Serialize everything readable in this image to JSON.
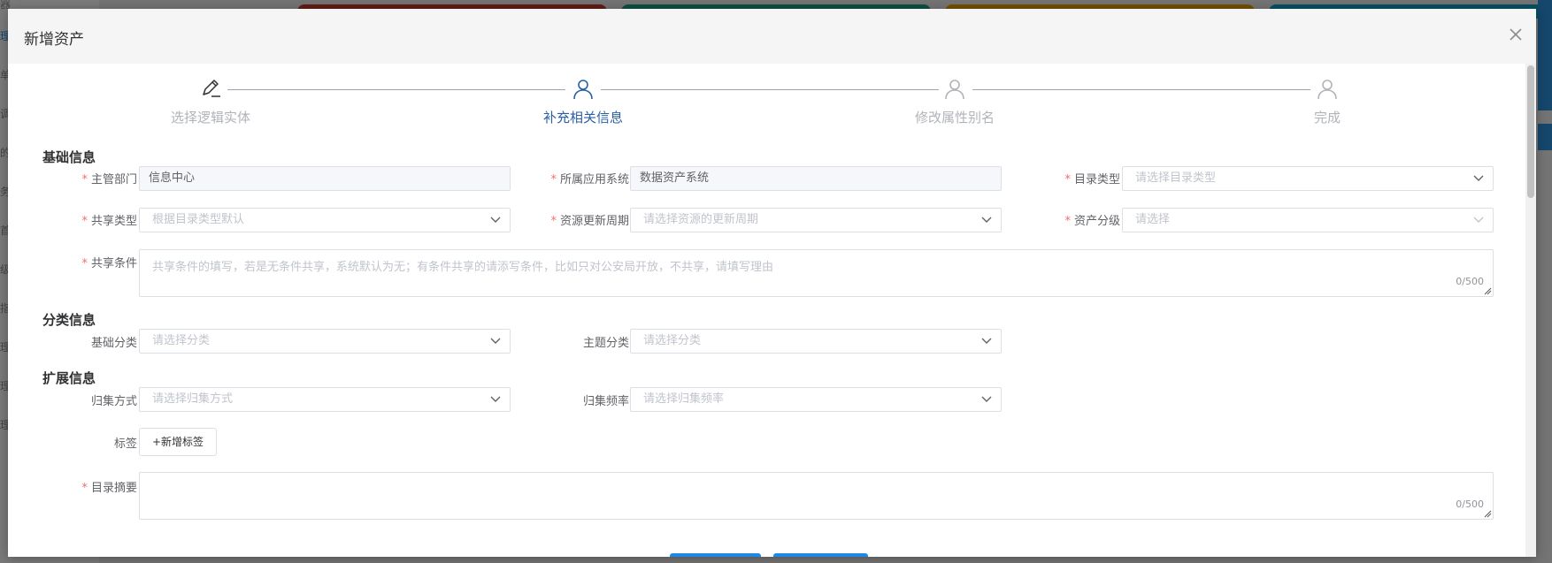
{
  "dialog": {
    "title": "新增资产"
  },
  "steps": [
    {
      "title": "选择逻辑实体",
      "icon": "edit-icon",
      "active": false
    },
    {
      "title": "补充相关信息",
      "icon": "user-icon",
      "active": true
    },
    {
      "title": "修改属性别名",
      "icon": "user-icon",
      "active": false
    },
    {
      "title": "完成",
      "icon": "user-icon",
      "active": false
    }
  ],
  "sections": {
    "basic": "基础信息",
    "category": "分类信息",
    "extend": "扩展信息"
  },
  "fields": {
    "department": {
      "label": "主管部门",
      "value": "信息中心",
      "required": true
    },
    "app_system": {
      "label": "所属应用系统",
      "value": "数据资产系统",
      "required": true
    },
    "catalog_type": {
      "label": "目录类型",
      "placeholder": "请选择目录类型",
      "required": true
    },
    "share_type": {
      "label": "共享类型",
      "placeholder": "根据目录类型默认",
      "required": true
    },
    "update_cycle": {
      "label": "资源更新周期",
      "placeholder": "请选择资源的更新周期",
      "required": true
    },
    "asset_level": {
      "label": "资产分级",
      "placeholder": "请选择",
      "required": true
    },
    "share_condition": {
      "label": "共享条件",
      "placeholder": "共享条件的填写，若是无条件共享，系统默认为无；有条件共享的请添写条件，比如只对公安局开放，不共享，请填写理由",
      "counter": "0/500",
      "required": true
    },
    "basic_category": {
      "label": "基础分类",
      "placeholder": "请选择分类"
    },
    "topic_category": {
      "label": "主题分类",
      "placeholder": "请选择分类"
    },
    "collect_method": {
      "label": "归集方式",
      "placeholder": "请选择归集方式"
    },
    "collect_frequency": {
      "label": "归集频率",
      "placeholder": "请选择归集频率"
    },
    "tags": {
      "label": "标签",
      "button": "+新增标签"
    },
    "summary": {
      "label": "目录摘要",
      "counter": "0/500",
      "required": true
    }
  },
  "background": {
    "left_fragments": [
      "器",
      "理",
      "单",
      "调",
      "的",
      "务",
      "首",
      "级",
      "指",
      "理",
      "理",
      "理"
    ]
  },
  "colors": {
    "primary": "#2a5fa5",
    "required": "#f56c6c",
    "button": "#1e88e5"
  }
}
